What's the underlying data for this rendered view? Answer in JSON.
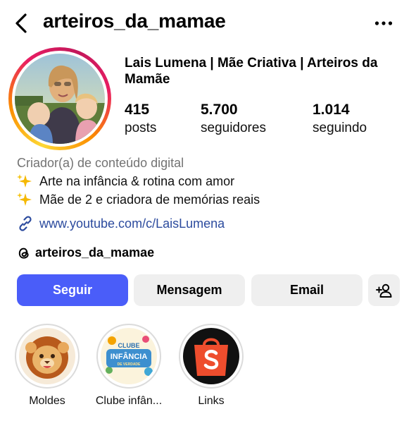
{
  "header": {
    "username": "arteiros_da_mamae",
    "back_icon": "chevron-left-icon",
    "more_icon": "more-horizontal-icon"
  },
  "profile": {
    "display_name": "Lais Lumena | Mãe Criativa | Arteiros da Mamãe",
    "stats": [
      {
        "value": "415",
        "label": "posts"
      },
      {
        "value": "5.700",
        "label": "seguidores"
      },
      {
        "value": "1.014",
        "label": "seguindo"
      }
    ],
    "category": "Criador(a) de conteúdo digital",
    "bio": [
      "Arte na infância & rotina com amor",
      "Mãe de 2 e criadora de memórias reais"
    ],
    "link": "www.youtube.com/c/LaisLumena",
    "threads_handle": "arteiros_da_mamae"
  },
  "actions": {
    "follow": "Seguir",
    "message": "Mensagem",
    "email": "Email",
    "add_person_icon": "add-person-icon"
  },
  "highlights": [
    {
      "label": "Moldes",
      "icon": "lion-icon"
    },
    {
      "label": "Clube infân...",
      "icon": "clube-infancia-logo"
    },
    {
      "label": "Links",
      "icon": "shopee-bag-icon"
    }
  ],
  "logo_text": {
    "clube_line1": "CLUBE",
    "clube_line2": "INFÂNCIA",
    "clube_line3": "DE VERDADE"
  },
  "colors": {
    "follow_button": "#4a5df9",
    "secondary_button": "#efefef",
    "link": "#2c4b9e",
    "muted_text": "#737373",
    "shopee_orange": "#ee4d2d"
  }
}
